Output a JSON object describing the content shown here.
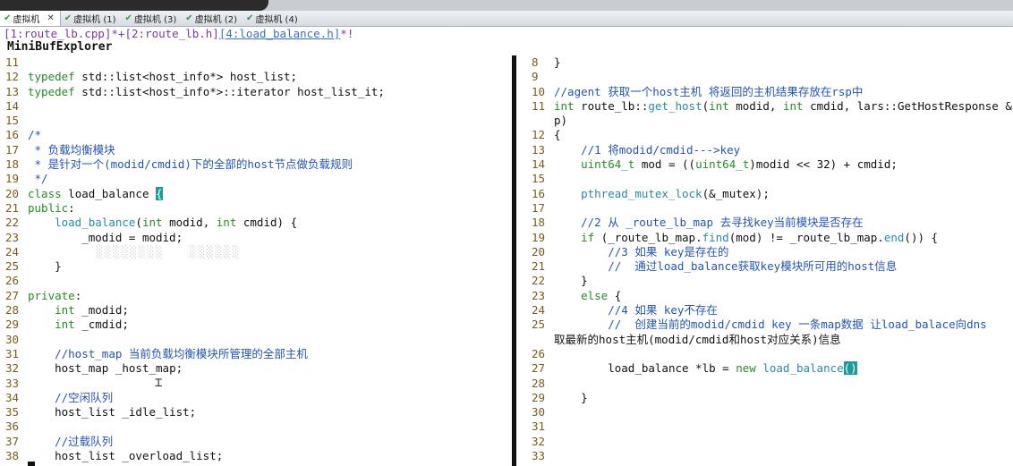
{
  "tabs": [
    {
      "label": "虚拟机",
      "active": true
    },
    {
      "label": "虚拟机 (1)",
      "active": false
    },
    {
      "label": "虚拟机 (3)",
      "active": false
    },
    {
      "label": "虚拟机 (2)",
      "active": false
    },
    {
      "label": "虚拟机 (4)",
      "active": false
    }
  ],
  "buffer_line": {
    "part1": "[1:route_lb.cpp]*+[2:route_lb.h]",
    "current": "[4:load_balance.h]",
    "part2": "*!"
  },
  "minibuf_title": "MiniBufExplorer",
  "left_pane": [
    {
      "n": "11",
      "t": ""
    },
    {
      "n": "12",
      "t": "typedef std::list<host_info*> host_list;"
    },
    {
      "n": "13",
      "t": "typedef std::list<host_info*>::iterator host_list_it;"
    },
    {
      "n": "14",
      "t": ""
    },
    {
      "n": "15",
      "t": ""
    },
    {
      "n": "16",
      "t": "/*"
    },
    {
      "n": "17",
      "t": " * 负载均衡模块"
    },
    {
      "n": "18",
      "t": " * 是针对一个(modid/cmdid)下的全部的host节点做负载规则"
    },
    {
      "n": "19",
      "t": " */"
    },
    {
      "n": "20",
      "t": "class load_balance {"
    },
    {
      "n": "21",
      "t": "public:"
    },
    {
      "n": "22",
      "t": "    load_balance(int modid, int cmdid) {"
    },
    {
      "n": "23",
      "t": "        _modid = modid;"
    },
    {
      "n": "24",
      "t": ""
    },
    {
      "n": "25",
      "t": "    }"
    },
    {
      "n": "26",
      "t": ""
    },
    {
      "n": "27",
      "t": "private:"
    },
    {
      "n": "28",
      "t": "    int _modid;"
    },
    {
      "n": "29",
      "t": "    int _cmdid;"
    },
    {
      "n": "30",
      "t": ""
    },
    {
      "n": "31",
      "t": "    //host_map 当前负载均衡模块所管理的全部主机"
    },
    {
      "n": "32",
      "t": "    host_map _host_map;"
    },
    {
      "n": "33",
      "t": ""
    },
    {
      "n": "34",
      "t": "    //空闲队列"
    },
    {
      "n": "35",
      "t": "    host_list _idle_list;"
    },
    {
      "n": "36",
      "t": ""
    },
    {
      "n": "37",
      "t": "    //过载队列"
    },
    {
      "n": "38",
      "t": "    host_list _overload_list;"
    }
  ],
  "right_pane": [
    {
      "n": "8",
      "t": "}"
    },
    {
      "n": "9",
      "t": ""
    },
    {
      "n": "10",
      "t": "//agent 获取一个host主机 将返回的主机结果存放在rsp中"
    },
    {
      "n": "11",
      "t": "int route_lb::get_host(int modid, int cmdid, lars::GetHostResponse &"
    },
    {
      "n": "",
      "t": "p)"
    },
    {
      "n": "12",
      "t": "{"
    },
    {
      "n": "13",
      "t": "    //1 将modid/cmdid--->key"
    },
    {
      "n": "14",
      "t": "    uint64_t mod = ((uint64_t)modid << 32) + cmdid;"
    },
    {
      "n": "15",
      "t": ""
    },
    {
      "n": "16",
      "t": "    pthread_mutex_lock(&_mutex);"
    },
    {
      "n": "17",
      "t": ""
    },
    {
      "n": "18",
      "t": "    //2 从 _route_lb_map 去寻找key当前模块是否存在"
    },
    {
      "n": "19",
      "t": "    if (_route_lb_map.find(mod) != _route_lb_map.end()) {"
    },
    {
      "n": "20",
      "t": "        //3 如果 key是存在的"
    },
    {
      "n": "21",
      "t": "        //  通过load_balance获取key模块所可用的host信息"
    },
    {
      "n": "22",
      "t": "    }"
    },
    {
      "n": "23",
      "t": "    else {"
    },
    {
      "n": "24",
      "t": "        //4 如果 key不存在"
    },
    {
      "n": "25",
      "t": "        //  创建当前的modid/cmdid key 一条map数据 让load_balace向dns"
    },
    {
      "n": "",
      "t": "取最新的host主机(modid/cmdid和host对应关系)信息"
    },
    {
      "n": "26",
      "t": ""
    },
    {
      "n": "27",
      "t": "        load_balance *lb = new load_balance()"
    },
    {
      "n": "28",
      "t": ""
    },
    {
      "n": "29",
      "t": "    }"
    },
    {
      "n": "30",
      "t": ""
    },
    {
      "n": "31",
      "t": ""
    },
    {
      "n": "32",
      "t": ""
    },
    {
      "n": "33",
      "t": ""
    }
  ]
}
